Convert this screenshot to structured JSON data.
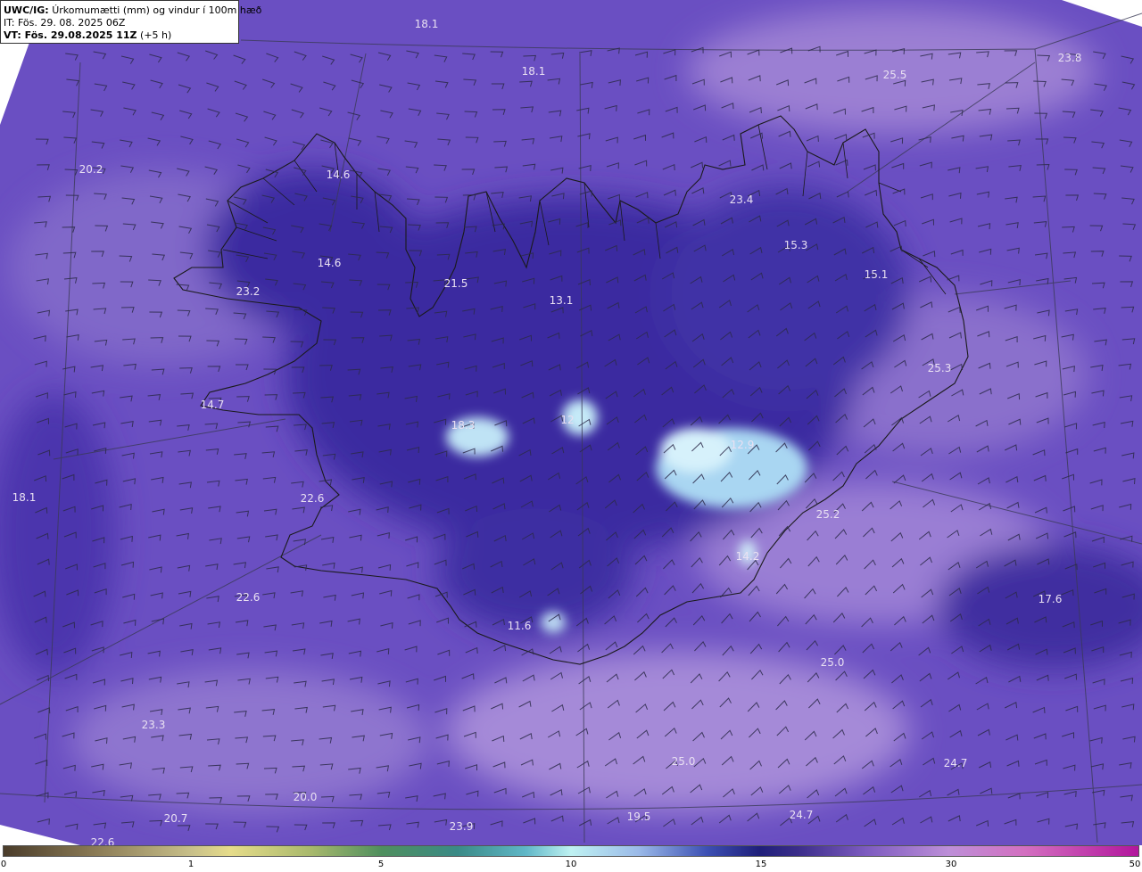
{
  "header": {
    "model": "UWC/IG:",
    "title": "Úrkomumætti (mm) og vindur í 100m hæð",
    "init_time": "IT: Fös. 29. 08. 2025 06Z",
    "valid_label": "VT: Fös. 29.08.2025 11Z",
    "valid_offset": "(+5 h)"
  },
  "map": {
    "region": "Iceland",
    "field": "precipitable water (mm)",
    "labels": [
      "18.1",
      "18.1",
      "25.5",
      "23.8",
      "20.2",
      "14.6",
      "14.6",
      "23.2",
      "21.5",
      "13.1",
      "23.4",
      "15.3",
      "15.1",
      "25.3",
      "14.7",
      "18.3",
      "12",
      "12.9",
      "18.1",
      "22.6",
      "25.2",
      "14.2",
      "17.6",
      "22.6",
      "11.6",
      "25.0",
      "23.3",
      "25.0",
      "24.7",
      "20.0",
      "20.7",
      "19.5",
      "24.7",
      "23.9",
      "22.6"
    ],
    "colors": {
      "background": "#6a4fc2",
      "dark": "#2a1f8a",
      "light": "#a68ad8",
      "ice": "#bfe3f5",
      "coast": "#1a1a1a",
      "grid": "#3a3a55",
      "barb": "#2c2a4a"
    }
  },
  "colorbar": {
    "ticks": [
      "0",
      "1",
      "5",
      "10",
      "15",
      "30",
      "50"
    ]
  }
}
